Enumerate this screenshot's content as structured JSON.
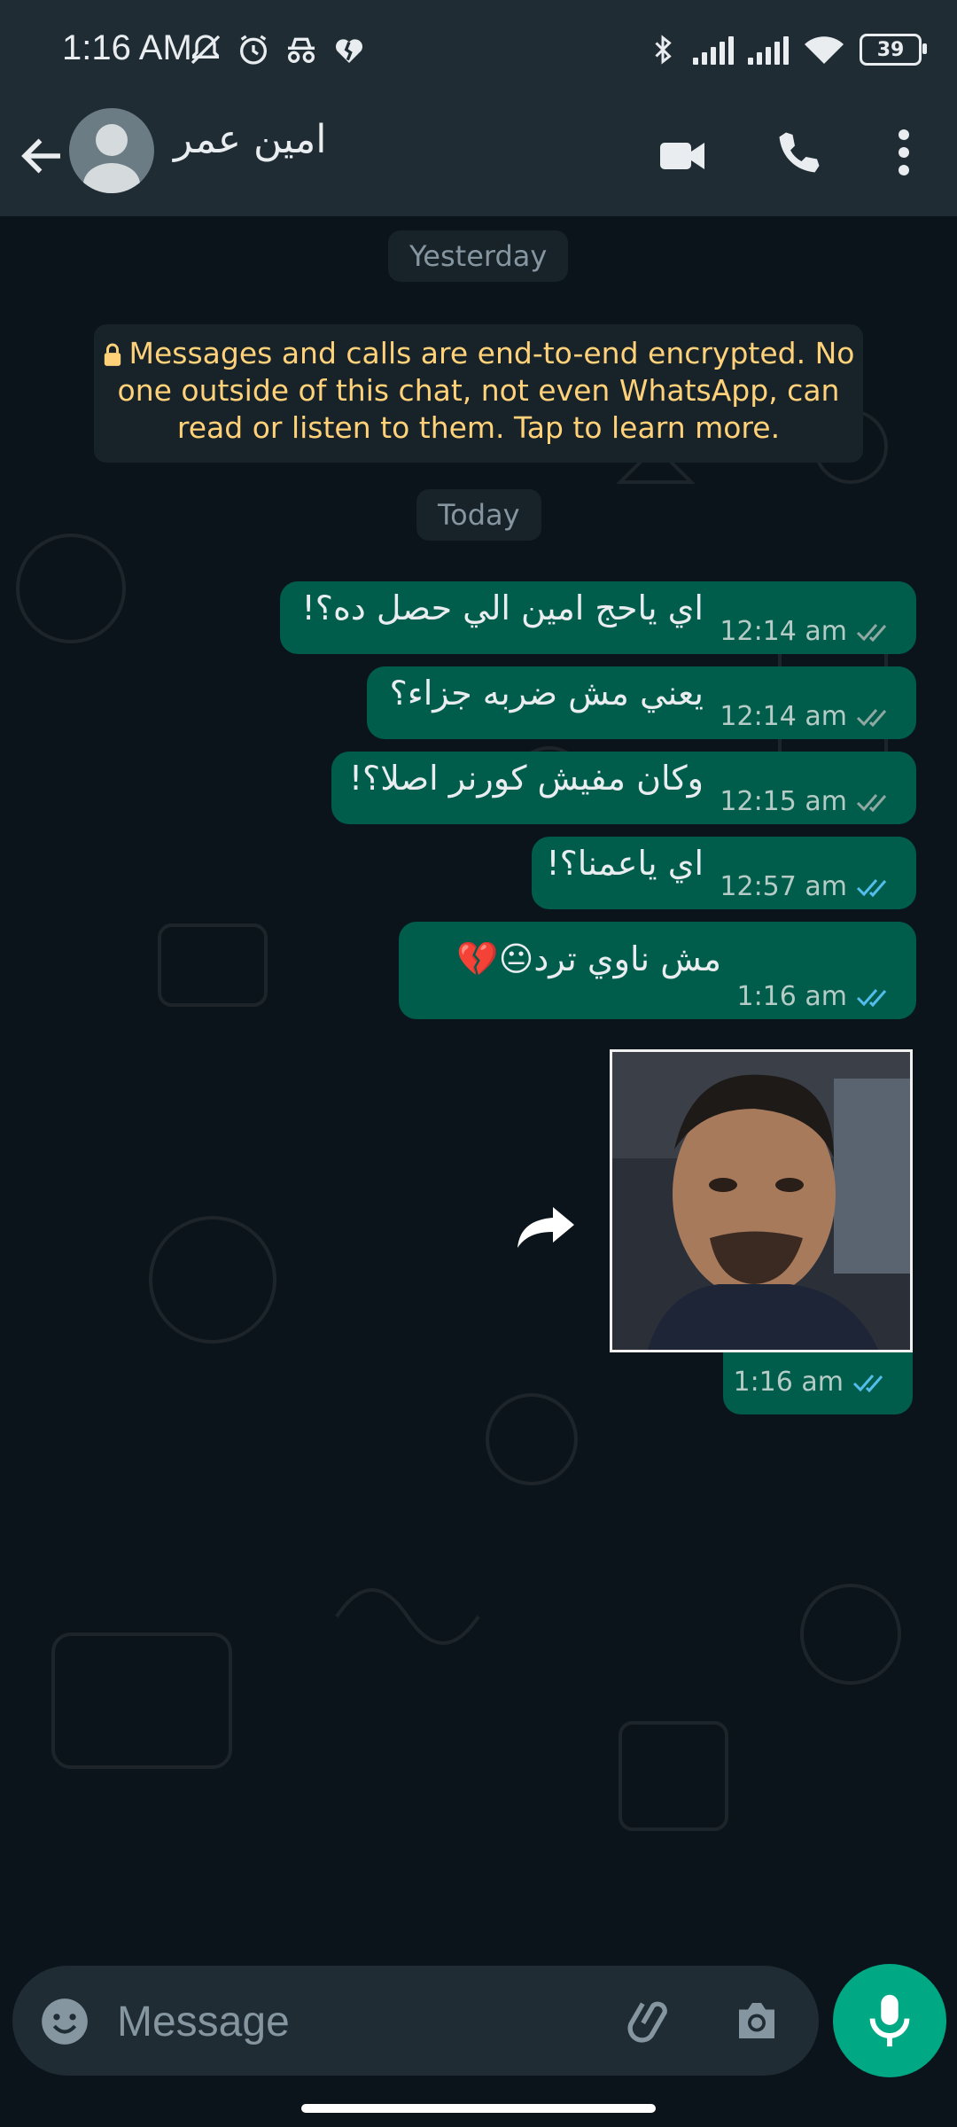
{
  "status_bar": {
    "time": "1:16 AM",
    "battery": "39",
    "icons": [
      "mute-bell-icon",
      "alarm-icon",
      "incognito-icon",
      "heart-broken-icon",
      "bluetooth-icon",
      "signal-icon",
      "signal-icon",
      "wifi-icon",
      "battery-icon"
    ]
  },
  "header": {
    "contact_name": "امين عمر",
    "icons": [
      "back-arrow-icon",
      "avatar",
      "video-call-icon",
      "voice-call-icon",
      "more-vert-icon"
    ]
  },
  "chat": {
    "date_yesterday": "Yesterday",
    "encryption_notice": "Messages and calls are end-to-end encrypted. No one outside of this chat, not even WhatsApp, can read or listen to them. Tap to learn more.",
    "date_today": "Today",
    "messages": [
      {
        "text": "اي ياحج امين الي حصل ده؟!",
        "time": "12:14 am",
        "status": "delivered"
      },
      {
        "text": "يعني مش ضربه جزاء؟",
        "time": "12:14 am",
        "status": "delivered"
      },
      {
        "text": "وكان مفيش كورنر اصلا؟!",
        "time": "12:15 am",
        "status": "delivered"
      },
      {
        "text": "اي ياعمنا؟!",
        "time": "12:57 am",
        "status": "read"
      },
      {
        "text": "مش ناوي ترد😐💔",
        "time": "1:16 am",
        "status": "read"
      }
    ],
    "image_message": {
      "time": "1:16 am",
      "status": "read"
    }
  },
  "input": {
    "placeholder": "Message"
  },
  "colors": {
    "bubble_out": "#005c4b",
    "header_bg": "#1f2c34",
    "chat_bg": "#0b141a",
    "read_tick": "#53bdeb",
    "delivered_tick": "#8fa8a2",
    "encryption_text": "#ffd279",
    "accent": "#00a884"
  }
}
